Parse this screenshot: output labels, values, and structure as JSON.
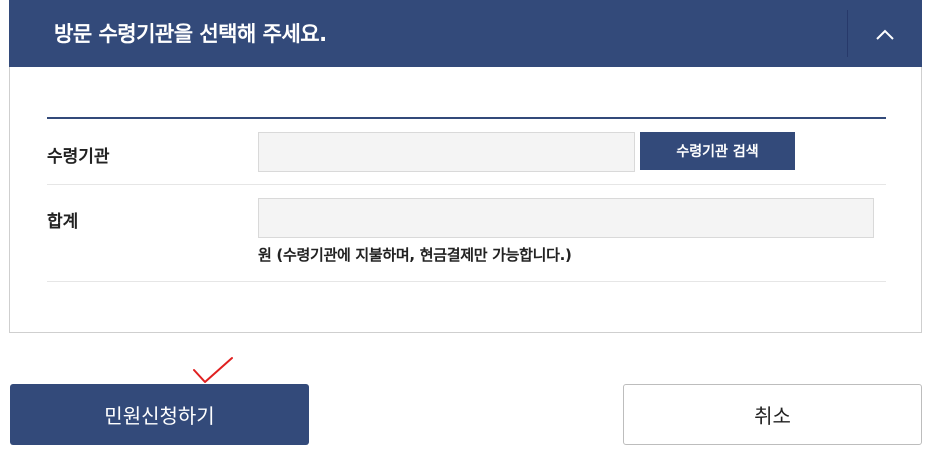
{
  "header": {
    "title": "방문 수령기관을 선택해 주세요.",
    "toggle_icon": "chevron-up-icon"
  },
  "form": {
    "agency": {
      "label": "수령기관",
      "value": "",
      "search_button": "수령기관 검색"
    },
    "total": {
      "label": "합계",
      "value": "",
      "note": "원 (수령기관에 지불하며, 현금결제만 가능합니다.)"
    }
  },
  "actions": {
    "submit": "민원신청하기",
    "cancel": "취소"
  },
  "annotation": {
    "mark_icon": "red-checkmark-icon",
    "color": "#e02020"
  },
  "colors": {
    "primary": "#334a7a"
  }
}
